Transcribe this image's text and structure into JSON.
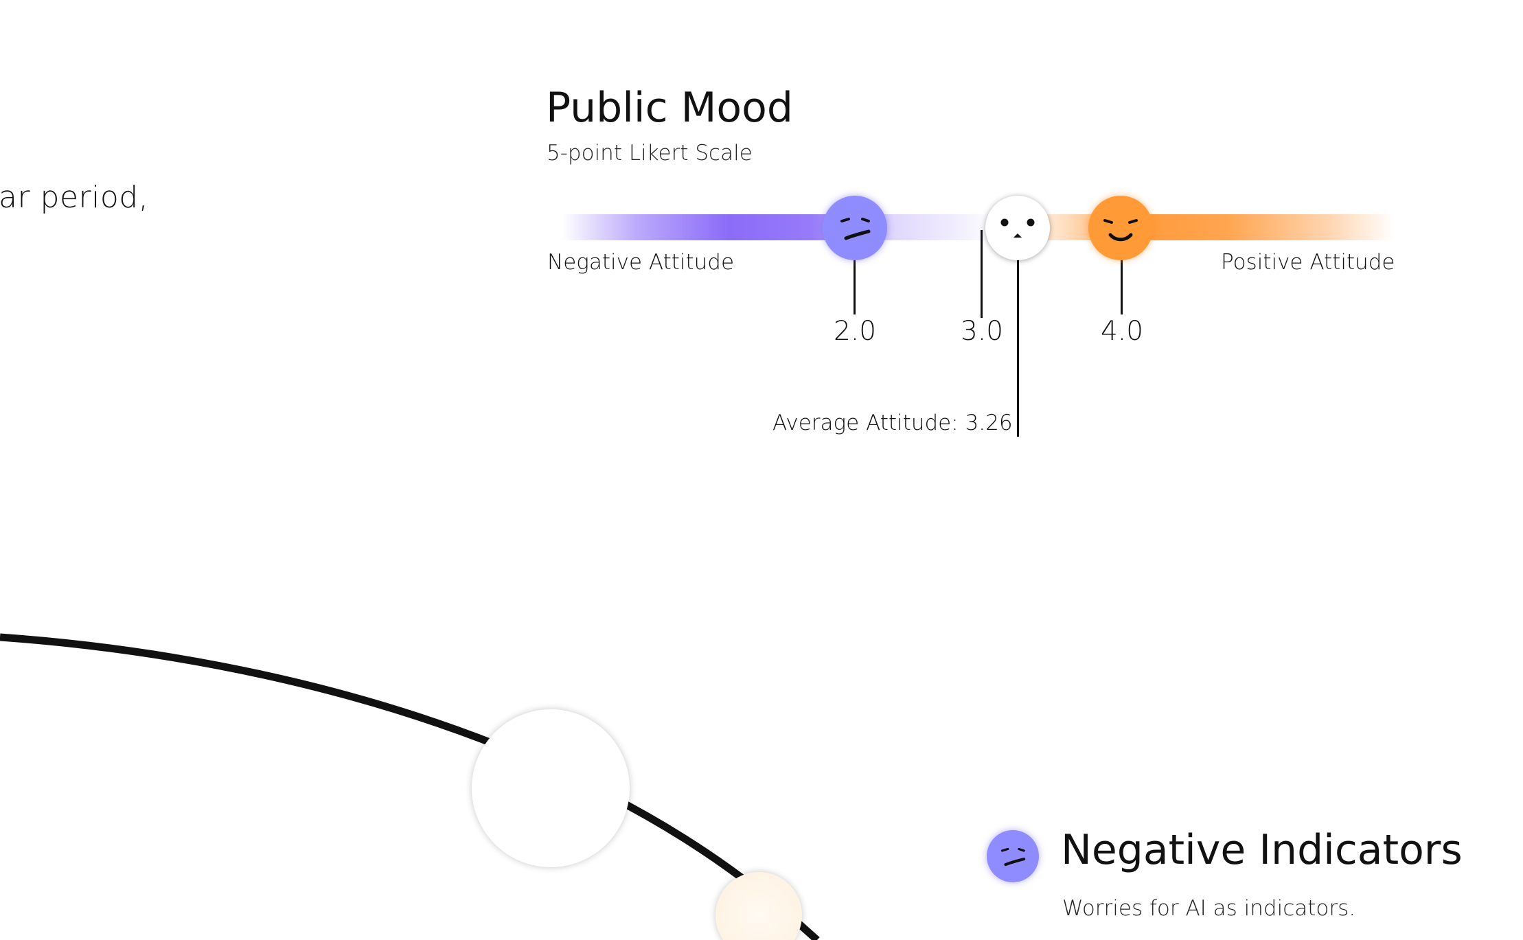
{
  "intro": {
    "text": "ar period,"
  },
  "mood": {
    "title": "Public Mood",
    "subtitle": "5-point Likert Scale",
    "negative_label": "Negative Attitude",
    "positive_label": "Positive Attitude",
    "ticks": [
      {
        "value": 2.0,
        "label": "2.0"
      },
      {
        "value": 3.0,
        "label": "3.0"
      },
      {
        "value": 4.0,
        "label": "4.0"
      }
    ],
    "average_value": 3.26,
    "average_label": "Average Attitude: 3.26",
    "faces": {
      "negative": {
        "icon": "frown-face-icon",
        "color": "#8e8cff"
      },
      "neutral": {
        "icon": "neutral-face-icon",
        "color": "#ffffff"
      },
      "positive": {
        "icon": "smile-face-icon",
        "color": "#ff9a36"
      }
    }
  },
  "legend": {
    "title": "Negative Indicators",
    "description": "Worries for AI as indicators.",
    "icon": "frown-face-icon",
    "color": "#8e8cff"
  },
  "colors": {
    "negative_accent": "#8464f8",
    "positive_accent": "#ff9632",
    "line": "#111111"
  }
}
